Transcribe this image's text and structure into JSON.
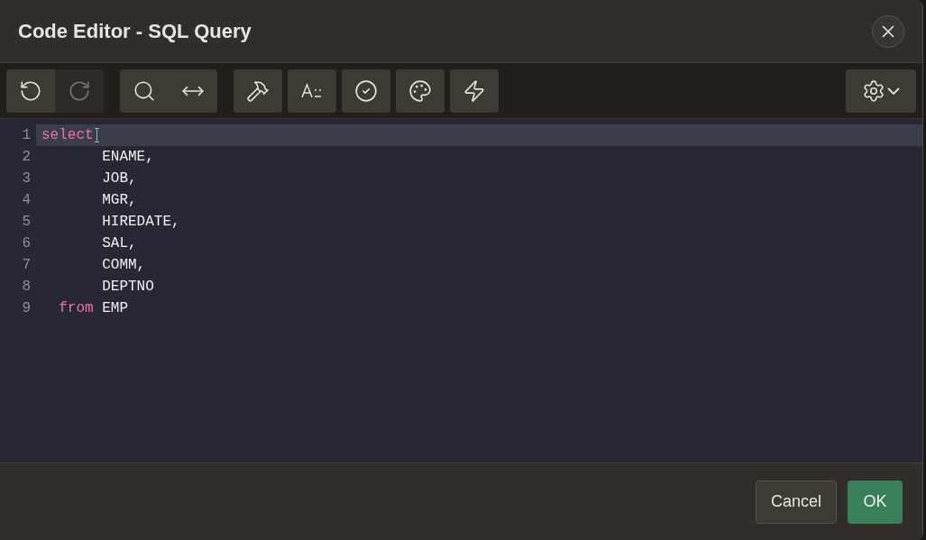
{
  "dialog": {
    "title": "Code Editor - SQL Query"
  },
  "toolbar": {
    "groups": [
      {
        "buttons": [
          {
            "kind": "undo",
            "disabled": false
          },
          {
            "kind": "redo",
            "disabled": true
          }
        ]
      },
      {
        "buttons": [
          {
            "kind": "search",
            "disabled": false
          },
          {
            "kind": "replace",
            "disabled": false
          }
        ]
      },
      {
        "buttons": [
          {
            "kind": "hammer",
            "disabled": false
          }
        ]
      },
      {
        "buttons": [
          {
            "kind": "format",
            "disabled": false
          }
        ]
      },
      {
        "buttons": [
          {
            "kind": "validate",
            "disabled": false
          }
        ]
      },
      {
        "buttons": [
          {
            "kind": "palette",
            "disabled": false
          }
        ]
      },
      {
        "buttons": [
          {
            "kind": "bolt",
            "disabled": false
          }
        ]
      }
    ]
  },
  "editor": {
    "lines": [
      {
        "number": "1",
        "current": true,
        "tokens": [
          {
            "kind": "keyword",
            "text": "select"
          }
        ]
      },
      {
        "number": "2",
        "current": false,
        "tokens": [
          {
            "kind": "plain",
            "text": "       ENAME,"
          }
        ]
      },
      {
        "number": "3",
        "current": false,
        "tokens": [
          {
            "kind": "plain",
            "text": "       JOB,"
          }
        ]
      },
      {
        "number": "4",
        "current": false,
        "tokens": [
          {
            "kind": "plain",
            "text": "       MGR,"
          }
        ]
      },
      {
        "number": "5",
        "current": false,
        "tokens": [
          {
            "kind": "plain",
            "text": "       HIREDATE,"
          }
        ]
      },
      {
        "number": "6",
        "current": false,
        "tokens": [
          {
            "kind": "plain",
            "text": "       SAL,"
          }
        ]
      },
      {
        "number": "7",
        "current": false,
        "tokens": [
          {
            "kind": "plain",
            "text": "       COMM,"
          }
        ]
      },
      {
        "number": "8",
        "current": false,
        "tokens": [
          {
            "kind": "plain",
            "text": "       DEPTNO"
          }
        ]
      },
      {
        "number": "9",
        "current": false,
        "tokens": [
          {
            "kind": "keyword",
            "text": "  from"
          },
          {
            "kind": "plain",
            "text": " EMP"
          }
        ]
      }
    ]
  },
  "buttons": [
    {
      "kind": "secondary",
      "label": "Cancel"
    },
    {
      "kind": "primary",
      "label": "OK"
    }
  ]
}
